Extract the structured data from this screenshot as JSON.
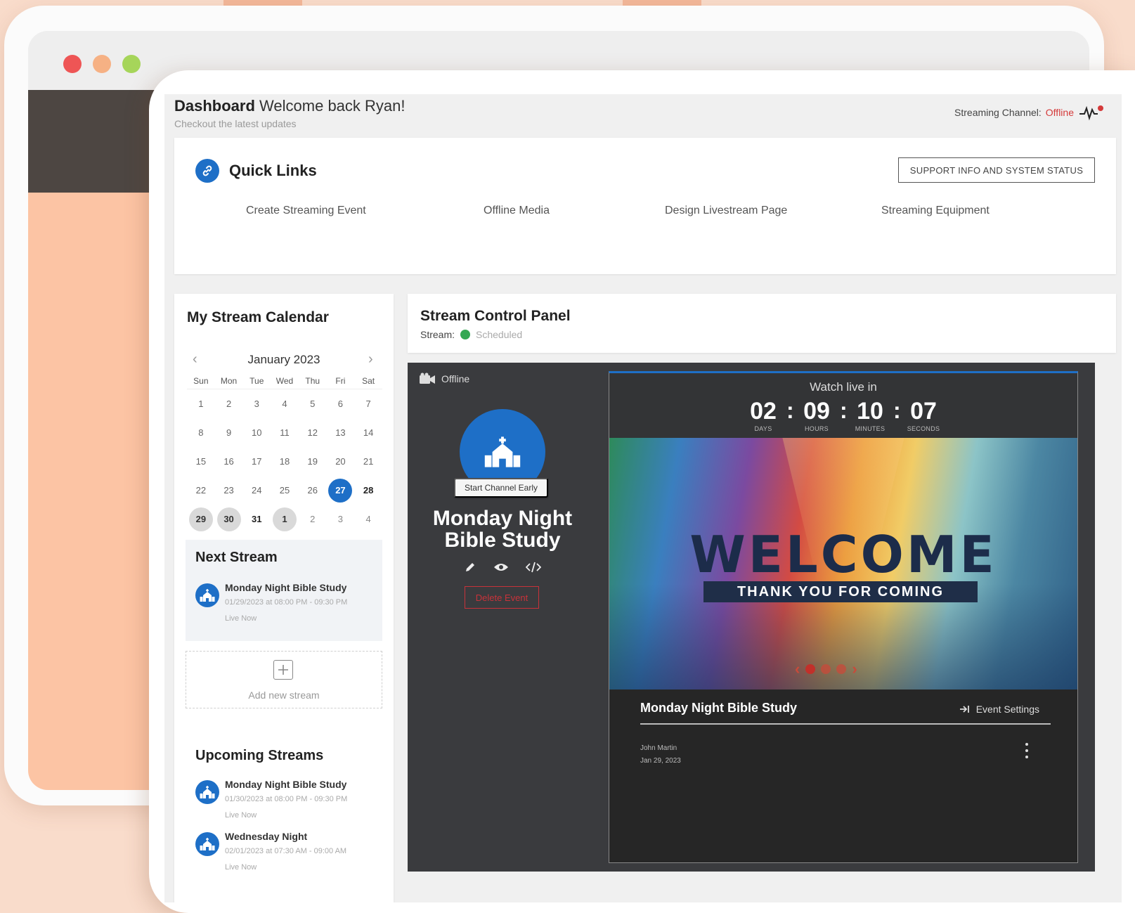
{
  "colors": {
    "accent": "#1e6fc7",
    "offline": "#d43a3a",
    "scheduled": "#34a853",
    "danger": "#c8323a"
  },
  "window_controls": {
    "close": "#ee5555",
    "minimize": "#f6b184",
    "maximize": "#a6d55a"
  },
  "header": {
    "title_bold": "Dashboard",
    "title_rest": "Welcome back Ryan!",
    "subtitle": "Checkout the latest updates",
    "channel_label": "Streaming Channel:",
    "channel_status": "Offline",
    "channel_icon": "pulse-icon"
  },
  "quick_links": {
    "icon": "link-icon",
    "title": "Quick Links",
    "support_button": "SUPPORT INFO AND SYSTEM STATUS",
    "links": [
      "Create Streaming Event",
      "Offline Media",
      "Design Livestream Page",
      "Streaming Equipment"
    ]
  },
  "calendar": {
    "title": "My Stream Calendar",
    "month": "January 2023",
    "weekdays": [
      "Sun",
      "Mon",
      "Tue",
      "Wed",
      "Thu",
      "Fri",
      "Sat"
    ],
    "weeks": [
      [
        "1",
        "2",
        "3",
        "4",
        "5",
        "6",
        "7"
      ],
      [
        "8",
        "9",
        "10",
        "11",
        "12",
        "13",
        "14"
      ],
      [
        "15",
        "16",
        "17",
        "18",
        "19",
        "20",
        "21"
      ],
      [
        "22",
        "23",
        "24",
        "25",
        "26",
        "27",
        "28"
      ],
      [
        "29",
        "30",
        "31",
        "1",
        "2",
        "3",
        "4"
      ]
    ]
  },
  "next_stream": {
    "title": "Next Stream",
    "item": {
      "name": "Monday Night Bible Study",
      "time": "01/29/2023 at 08:00 PM - 09:30 PM",
      "status": "Live Now"
    }
  },
  "add_stream": {
    "label": "Add new stream"
  },
  "upcoming": {
    "title": "Upcoming Streams",
    "items": [
      {
        "name": "Monday Night Bible Study",
        "time": "01/30/2023 at 08:00 PM - 09:30 PM",
        "status": "Live Now"
      },
      {
        "name": "Wednesday Night",
        "time": "02/01/2023 at 07:30 AM - 09:00 AM",
        "status": "Live Now"
      }
    ]
  },
  "control_panel": {
    "title": "Stream Control Panel",
    "stream_label": "Stream:",
    "stream_status": "Scheduled",
    "camera_status": "Offline",
    "start_early": "Start Channel Early",
    "event_title_line1": "Monday Night",
    "event_title_line2": "Bible Study",
    "delete_button": "Delete Event",
    "tools": [
      "pencil-icon",
      "eye-icon",
      "code-icon"
    ]
  },
  "preview": {
    "watch_live": "Watch live in",
    "countdown": [
      {
        "value": "02",
        "label": "DAYS"
      },
      {
        "value": "09",
        "label": "HOURS"
      },
      {
        "value": "10",
        "label": "MINUTES"
      },
      {
        "value": "07",
        "label": "SECONDS"
      }
    ],
    "hero_title": "WELCOME",
    "hero_subtitle": "THANK YOU FOR COMING",
    "carousel_active": 1,
    "event_name": "Monday Night Bible Study",
    "event_settings": "Event Settings",
    "author": "John Martin",
    "date": "Jan 29, 2023"
  }
}
